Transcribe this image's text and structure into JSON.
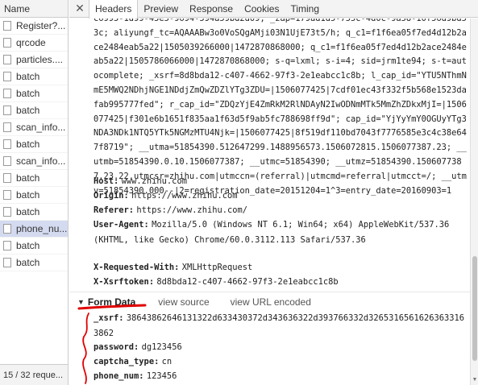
{
  "network": {
    "header": "Name",
    "items": [
      {
        "label": "Register?...",
        "selected": false
      },
      {
        "label": "qrcode",
        "selected": false
      },
      {
        "label": "particles....",
        "selected": false
      },
      {
        "label": "batch",
        "selected": false
      },
      {
        "label": "batch",
        "selected": false
      },
      {
        "label": "batch",
        "selected": false
      },
      {
        "label": "scan_info...",
        "selected": false
      },
      {
        "label": "batch",
        "selected": false
      },
      {
        "label": "scan_info...",
        "selected": false
      },
      {
        "label": "batch",
        "selected": false
      },
      {
        "label": "batch",
        "selected": false
      },
      {
        "label": "batch",
        "selected": false
      },
      {
        "label": "phone_nu...",
        "selected": true
      },
      {
        "label": "batch",
        "selected": false
      },
      {
        "label": "batch",
        "selected": false
      }
    ],
    "footer": "15 / 32 reque..."
  },
  "tabs": [
    {
      "label": "Headers",
      "active": true
    },
    {
      "label": "Preview",
      "active": false
    },
    {
      "label": "Response",
      "active": false
    },
    {
      "label": "Cookies",
      "active": false
    },
    {
      "label": "Timing",
      "active": false
    }
  ],
  "cookie_text": "c6995-1d99-45e5-9694-594a59bd2d09; _zap=179ad1d5-755c-4d0c-9a58-10f56d9bd53c; aliyungf_tc=AQAAABw3o0VoSQgAMji03N1UjE73t5/h; q_c1=f1f6ea05f7ed4d12b2ace2484eab5a22|1505039266000|1472870868000; q_c1=f1f6ea05f7ed4d12b2ace2484eab5a22|1505786066000|1472870868000; s-q=lxml; s-i=4; sid=jrm1te94; s-t=autocomplete; _xsrf=8d8bda12-c407-4662-97f3-2e1eabcc1c8b; l_cap_id=\"YTU5NThmNmE5MWQ2NDhjNGE1NDdjZmQwZDZlYTg3ZDU=|1506077425|7cdf01ec43f332f5b568e1523dafab995777fed\"; r_cap_id=\"ZDQzYjE4ZmRkM2RlNDAyN2IwODNmMTk5MmZhZDkxMjI=|1506077425|f301e6b1651f835aa1f63d5f9ab5fc788698ff9d\"; cap_id=\"YjYyYmY0OGUyYTg3NDA3NDk1NTQ5YTk5NGMzMTU4Njk=|1506077425|8f519df110bd7043f7776585e3c4c38e647f8719\"; __utma=51854390.512647299.1488956573.1506072815.1506077387.23; __utmb=51854390.0.10.1506077387; __utmc=51854390; __utmz=51854390.1506077387.23.22.utmcsr=zhihu.com|utmccn=(referral)|utmcmd=referral|utmcct=/; __utmv=51854390.000--|2=registration_date=20151204=1^3=entry_date=20160903=1",
  "headers": [
    {
      "name": "Host:",
      "value": "www.zhihu.com"
    },
    {
      "name": "Origin:",
      "value": "https://www.zhihu.com"
    },
    {
      "name": "Referer:",
      "value": "https://www.zhihu.com/"
    },
    {
      "name": "User-Agent:",
      "value": "Mozilla/5.0 (Windows NT 6.1; Win64; x64) AppleWebKit/537.36 (KHTML, like Gecko) Chrome/60.0.3112.113 Safari/537.36"
    },
    {
      "name": "X-Requested-With:",
      "value": "XMLHttpRequest"
    },
    {
      "name": "X-Xsrftoken:",
      "value": "8d8bda12-c407-4662-97f3-2e1eabcc1c8b"
    }
  ],
  "form_data": {
    "title": "Form Data",
    "view_source": "view source",
    "view_url_encoded": "view URL encoded",
    "params": [
      {
        "name": "_xsrf:",
        "value": "38643862646131322d633430372d343636322d393766332d32653165616263633163862"
      },
      {
        "name": "password:",
        "value": "dg123456"
      },
      {
        "name": "captcha_type:",
        "value": "cn"
      },
      {
        "name": "phone_num:",
        "value": "123456"
      }
    ]
  },
  "icons": {
    "close": "close-icon",
    "expand": "triangle-down-icon",
    "file": "file-icon"
  },
  "colors": {
    "selected_row": "#d4dbf0",
    "annotation": "#e00000"
  }
}
